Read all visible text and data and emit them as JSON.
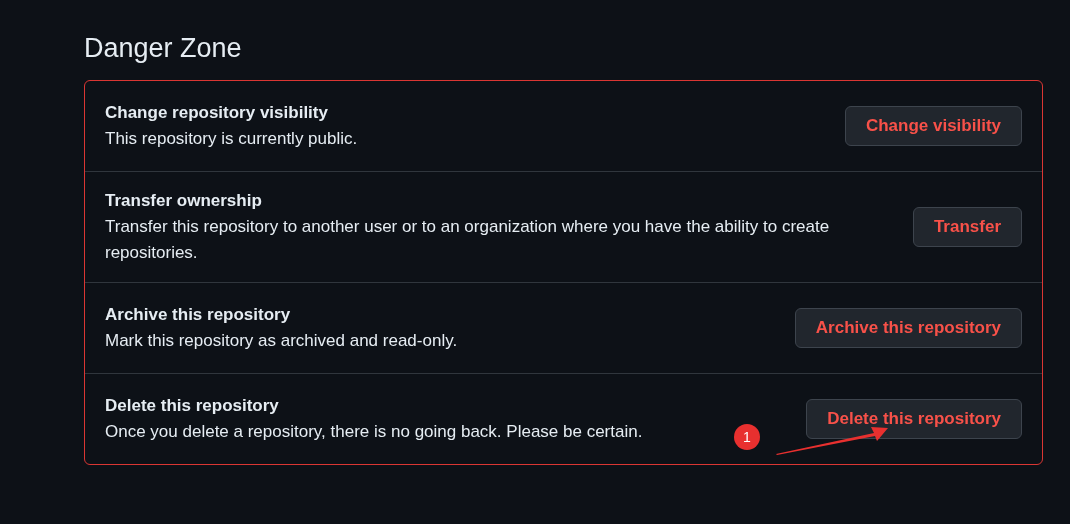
{
  "heading": "Danger Zone",
  "rows": [
    {
      "title": "Change repository visibility",
      "description": "This repository is currently public.",
      "button": "Change visibility"
    },
    {
      "title": "Transfer ownership",
      "description": "Transfer this repository to another user or to an organization where you have the ability to create repositories.",
      "button": "Transfer"
    },
    {
      "title": "Archive this repository",
      "description": "Mark this repository as archived and read-only.",
      "button": "Archive this repository"
    },
    {
      "title": "Delete this repository",
      "description": "Once you delete a repository, there is no going back. Please be certain.",
      "button": "Delete this repository"
    }
  ],
  "annotation": {
    "badge": "1"
  }
}
